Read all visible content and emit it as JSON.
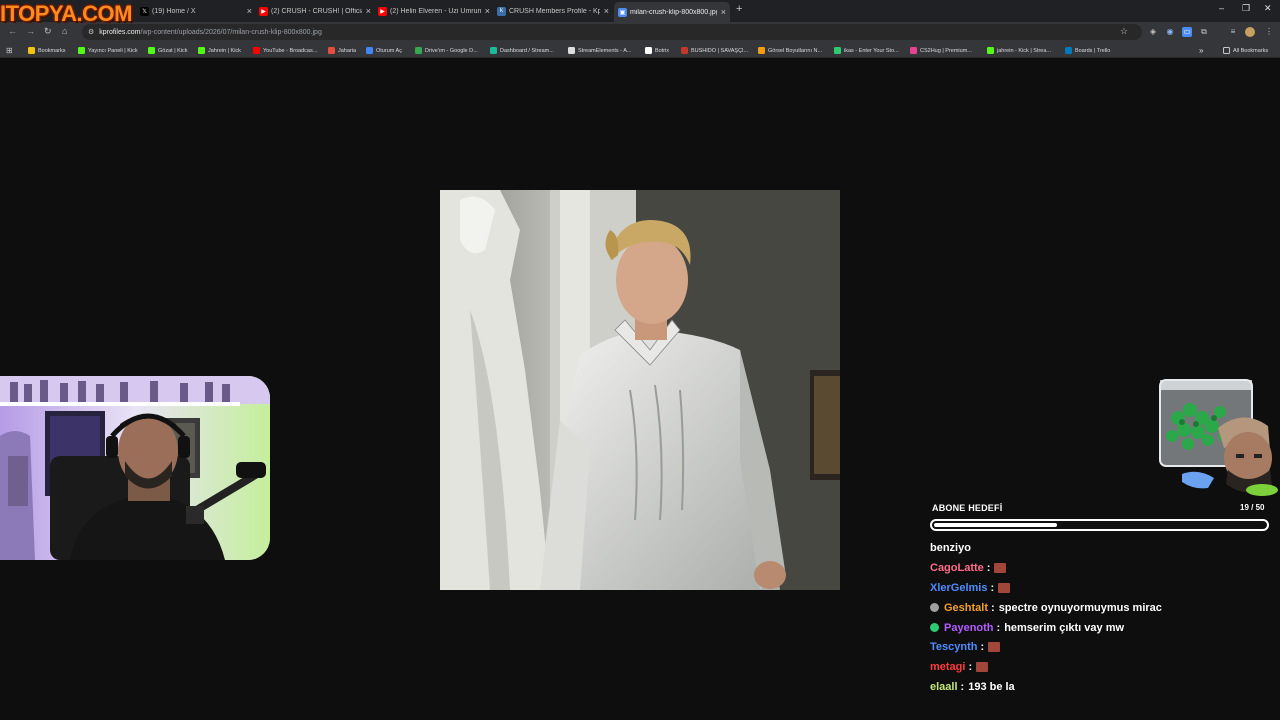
{
  "logo": {
    "text": "ITOPYA.COM"
  },
  "tabs": [
    {
      "title": "(19) Home / X",
      "icon": "x-logo-icon",
      "color": "#000000"
    },
    {
      "title": "(2) CRUSH - CRUSH! | Official M",
      "icon": "youtube-icon",
      "color": "#ff0000"
    },
    {
      "title": "(2) Helin Elveren - Uzi Umrum",
      "icon": "youtube-icon",
      "color": "#ff0000"
    },
    {
      "title": "CRUSH Members Profile - Kpop",
      "icon": "kprofiles-icon",
      "color": "#3b6ea5"
    },
    {
      "title": "milan-crush-klip-800x800.jpg",
      "icon": "image-file-icon",
      "color": "#4c8bf5",
      "active": true
    }
  ],
  "url": {
    "host": "kprofiles.com",
    "path": "/wp-content/uploads/2026/07/milan-crush-klip-800x800.jpg"
  },
  "bookmarks": [
    {
      "label": "Bookmarks",
      "color": "#f1c40f"
    },
    {
      "label": "Yayıncı Paneli | Kick",
      "color": "#53fc18"
    },
    {
      "label": "Gözat | Kick",
      "color": "#53fc18"
    },
    {
      "label": "Jahrein | Kick",
      "color": "#53fc18"
    },
    {
      "label": "YouTube - Broadcas...",
      "color": "#ff0000"
    },
    {
      "label": "Jaharia",
      "color": "#e74c3c"
    },
    {
      "label": "Oturum Aç",
      "color": "#4285f4"
    },
    {
      "label": "Drive'ım - Google D...",
      "color": "#34a853"
    },
    {
      "label": "Dashboard / Stream...",
      "color": "#1abc9c"
    },
    {
      "label": "StreamElements - A...",
      "color": "#dddddd"
    },
    {
      "label": "Botrix",
      "color": "#ffffff"
    },
    {
      "label": "BUSHIDO | SAVAŞÇI...",
      "color": "#c0392b"
    },
    {
      "label": "Görsel Boyutlarını N...",
      "color": "#f39c12"
    },
    {
      "label": "ikas - Enter Your Sto...",
      "color": "#2ecc71"
    },
    {
      "label": "CS2Hug | Premium...",
      "color": "#e84393"
    },
    {
      "label": "jahrein - Kick | Strea...",
      "color": "#53fc18"
    },
    {
      "label": "Boards | Trello",
      "color": "#0079bf"
    }
  ],
  "all_bookmarks": "All Bookmarks",
  "sub_goal": {
    "label": "ABONE HEDEFİ",
    "current": 19,
    "target": 50,
    "count_text": "19 / 50"
  },
  "chat": [
    {
      "user": "benziyo",
      "user_color": "#ffffff",
      "text": "",
      "continuation": true
    },
    {
      "user": "CagoLatte",
      "user_color": "#ff6b8a",
      "text": "",
      "emote": true
    },
    {
      "user": "XlerGelmis",
      "user_color": "#4f8cff",
      "text": "",
      "emote": true
    },
    {
      "user": "Geshtalt",
      "user_color": "#f0a02c",
      "text": "spectre oynuyormuymus mirac",
      "badge_color": "#9e9e9e"
    },
    {
      "user": "Payenoth",
      "user_color": "#b45cff",
      "text": "hemserim çıktı vay mw",
      "badge_color": "#2ecc71"
    },
    {
      "user": "Tescynth",
      "user_color": "#4f8cff",
      "text": "",
      "emote": true
    },
    {
      "user": "metagi",
      "user_color": "#ff3b3b",
      "text": "",
      "emote": true
    },
    {
      "user": "elaall",
      "user_color": "#c6e87a",
      "text": "193 be la"
    }
  ]
}
